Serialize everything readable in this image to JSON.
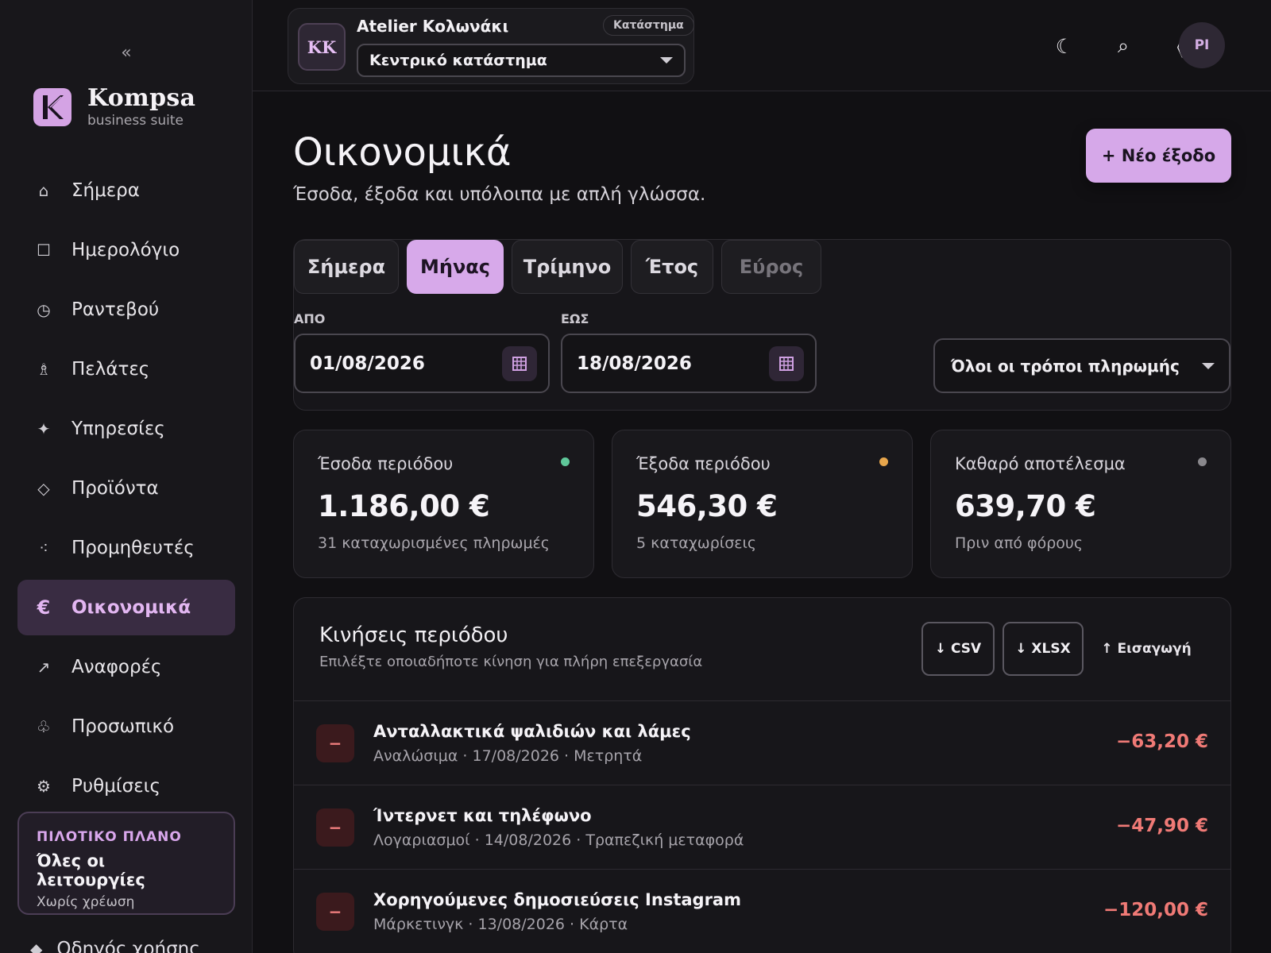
{
  "sidebar": {
    "collapse_icon": "«",
    "brand": {
      "name": "Kompsa",
      "subtitle": "business suite"
    },
    "items": [
      {
        "label": "Σήμερα",
        "icon": "home-icon",
        "glyph": "⌂"
      },
      {
        "label": "Ημερολόγιο",
        "icon": "calendar-icon",
        "glyph": "☐"
      },
      {
        "label": "Ραντεβού",
        "icon": "clock-icon",
        "glyph": "◷"
      },
      {
        "label": "Πελάτες",
        "icon": "clients-icon",
        "glyph": "♗"
      },
      {
        "label": "Υπηρεσίες",
        "icon": "sparkle-icon",
        "glyph": "✦"
      },
      {
        "label": "Προϊόντα",
        "icon": "product-icon",
        "glyph": "◇"
      },
      {
        "label": "Προμηθευτές",
        "icon": "suppliers-icon",
        "glyph": "⁖"
      },
      {
        "label": "Οικονομικά",
        "icon": "euro-icon",
        "glyph": "€",
        "active": true
      },
      {
        "label": "Αναφορές",
        "icon": "arrow-up-right-icon",
        "glyph": "↗"
      },
      {
        "label": "Προσωπικό",
        "icon": "staff-icon",
        "glyph": "♧"
      },
      {
        "label": "Ρυθμίσεις",
        "icon": "gear-icon",
        "glyph": "⚙"
      }
    ],
    "plan": {
      "badge": "ΠΙΛΟΤΙΚΟ ΠΛΑΝΟ",
      "title": "Όλες οι λειτουργίες",
      "subtitle": "Χωρίς χρέωση"
    },
    "guide": {
      "label": "Οδηγός χρήσης",
      "glyph": "◆"
    }
  },
  "topbar": {
    "store": {
      "initials": "KK",
      "name": "Atelier Κολωνάκι",
      "chip": "Κατάστημα",
      "selected_branch": "Κεντρικό κατάστημα"
    },
    "icons": [
      {
        "name": "moon-icon",
        "glyph": "☾"
      },
      {
        "name": "search-icon",
        "glyph": "⌕"
      },
      {
        "name": "diamond-icon",
        "glyph": "◊"
      }
    ],
    "user_initials": "PI"
  },
  "main": {
    "title": "Οικονομικά",
    "subtitle": "Έσοδα, έξοδα και υπόλοιπα με απλή γλώσσα.",
    "new_expense_label": "+ Νέο έξοδο",
    "tabs": [
      {
        "label": "Σήμερα",
        "state": "normal"
      },
      {
        "label": "Μήνας",
        "state": "active"
      },
      {
        "label": "Τρίμηνο",
        "state": "normal"
      },
      {
        "label": "Έτος",
        "state": "normal"
      },
      {
        "label": "Εύρος",
        "state": "muted"
      }
    ],
    "from_label": "ΑΠΟ",
    "from_value": "01/08/2026",
    "to_label": "ΕΩΣ",
    "to_value": "18/08/2026",
    "payment_filter": "Όλοι οι τρόποι πληρωμής",
    "stats": [
      {
        "label": "Έσοδα περιόδου",
        "value": "1.186,00 €",
        "note": "31 καταχωρισμένες πληρωμές",
        "dot_color": "#5fc79a"
      },
      {
        "label": "Έξοδα περιόδου",
        "value": "546,30 €",
        "note": "5 καταχωρίσεις",
        "dot_color": "#e8a64c"
      },
      {
        "label": "Καθαρό αποτέλεσμα",
        "value": "639,70 €",
        "note": "Πριν από φόρους",
        "dot_color": "#8a888d"
      }
    ],
    "transactions": {
      "title": "Κινήσεις περιόδου",
      "subtitle": "Επιλέξτε οποιαδήποτε κίνηση για πλήρη επεξεργασία",
      "csv_label": "↓ CSV",
      "xlsx_label": "↓ XLSX",
      "import_label": "↑ Εισαγωγή",
      "rows": [
        {
          "sign": "−",
          "name": "Ανταλλακτικά ψαλιδιών και λάμες",
          "meta": "Αναλώσιμα · 17/08/2026 · Μετρητά",
          "amount": "−63,20 €"
        },
        {
          "sign": "−",
          "name": "Ίντερνετ και τηλέφωνο",
          "meta": "Λογαριασμοί · 14/08/2026 · Τραπεζική μεταφορά",
          "amount": "−47,90 €"
        },
        {
          "sign": "−",
          "name": "Χορηγούμενες δημοσιεύσεις Instagram",
          "meta": "Μάρκετινγκ · 13/08/2026 · Κάρτα",
          "amount": "−120,00 €"
        }
      ]
    }
  }
}
